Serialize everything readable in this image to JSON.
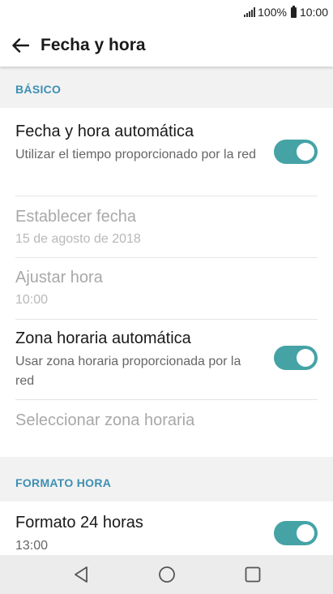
{
  "status_bar": {
    "battery": "100%",
    "time": "10:00"
  },
  "app_bar": {
    "title": "Fecha y hora",
    "back_icon": "arrow-left-icon"
  },
  "sections": {
    "basic": {
      "header": "BÁSICO"
    },
    "time_format": {
      "header": "FORMATO HORA"
    }
  },
  "settings": {
    "auto_datetime": {
      "title": "Fecha y hora automática",
      "summary": "Utilizar el tiempo proporcionado por la red",
      "enabled": true
    },
    "set_date": {
      "title": "Establecer fecha",
      "summary": "15 de agosto de 2018"
    },
    "set_time": {
      "title": "Ajustar hora",
      "summary": "10:00"
    },
    "auto_timezone": {
      "title": "Zona horaria automática",
      "summary": "Usar zona horaria proporcionada por la red",
      "enabled": true
    },
    "select_timezone": {
      "title": "Seleccionar zona horaria"
    },
    "format_24h": {
      "title": "Formato 24 horas",
      "summary": "13:00",
      "enabled": true
    }
  },
  "colors": {
    "accent": "#45a3a6",
    "section_header": "#3d8fb3"
  },
  "nav_bar": {
    "back": "triangle-back-icon",
    "home": "circle-home-icon",
    "recents": "square-recents-icon"
  }
}
